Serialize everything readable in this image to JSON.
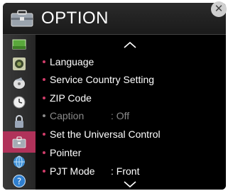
{
  "header": {
    "title": "OPTION",
    "icon": "toolbox-icon",
    "close_icon": "close-icon",
    "close_glyph": "✕"
  },
  "sidebar": {
    "items": [
      {
        "icon": "picture-icon"
      },
      {
        "icon": "sound-icon"
      },
      {
        "icon": "channel-icon"
      },
      {
        "icon": "time-icon"
      },
      {
        "icon": "lock-icon"
      },
      {
        "icon": "option-icon",
        "active": true
      },
      {
        "icon": "network-icon"
      },
      {
        "icon": "support-icon"
      }
    ],
    "active_color": "#b0325a"
  },
  "menu": {
    "scroll_up_icon": "chevron-up-icon",
    "scroll_down_icon": "chevron-down-icon",
    "items": [
      {
        "label": "Language"
      },
      {
        "label": "Service Country Setting"
      },
      {
        "label": "ZIP Code"
      },
      {
        "label": "Caption",
        "value": ": Off",
        "disabled": true
      },
      {
        "label": "Set the Universal Control"
      },
      {
        "label": "Pointer"
      },
      {
        "label": "PJT Mode",
        "value": ": Front"
      }
    ],
    "bullet_color": "#d03c6a"
  }
}
